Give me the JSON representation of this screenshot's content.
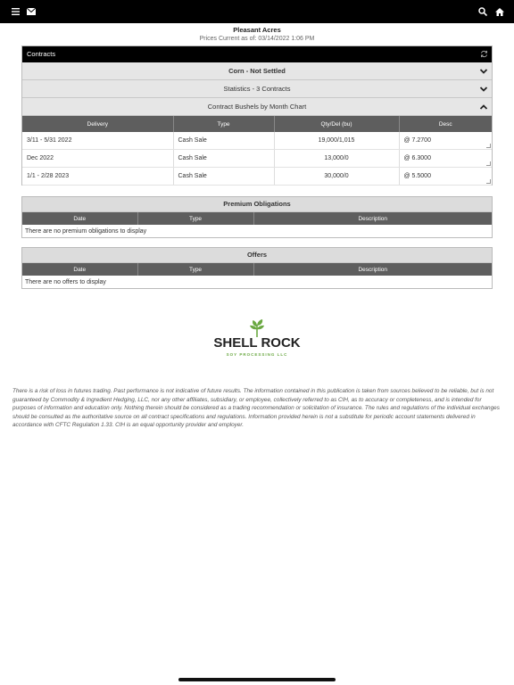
{
  "header": {
    "farm_name": "Pleasant Acres",
    "prices_current": "Prices Current as of: 03/14/2022 1:06 PM"
  },
  "contracts": {
    "title": "Contracts",
    "sections": [
      {
        "label": "Corn - Not Settled"
      },
      {
        "label": "Statistics - 3 Contracts"
      },
      {
        "label": "Contract Bushels by Month Chart"
      }
    ],
    "columns": [
      "Delivery",
      "Type",
      "Qty/Del (bu)",
      "Desc"
    ],
    "rows": [
      {
        "delivery": "3/11 - 5/31 2022",
        "type": "Cash Sale",
        "qty": "19,000/1,015",
        "desc": "@ 7.2700"
      },
      {
        "delivery": "Dec 2022",
        "type": "Cash Sale",
        "qty": "13,000/0",
        "desc": "@ 6.3000"
      },
      {
        "delivery": "1/1 - 2/28 2023",
        "type": "Cash Sale",
        "qty": "30,000/0",
        "desc": "@ 5.5000"
      }
    ]
  },
  "premium": {
    "title": "Premium Obligations",
    "columns": [
      "Date",
      "Type",
      "Description"
    ],
    "empty_text": "There are no premium obligations to display"
  },
  "offers": {
    "title": "Offers",
    "columns": [
      "Date",
      "Type",
      "Description"
    ],
    "empty_text": "There are no offers to display"
  },
  "logo": {
    "name": "SHELL ROCK",
    "sub": "SOY PROCESSING LLC"
  },
  "disclaimer": "There is a risk of loss in futures trading. Past performance is not indicative of future results. The information contained in this publication is taken from sources believed to be reliable, but is not guaranteed by Commodity & Ingredient Hedging, LLC, nor any other affiliates, subsidiary, or employee, collectively referred to as CIH, as to accuracy or completeness, and is intended for purposes of information and education only. Nothing therein should be considered as a trading recommendation or solicitation of insurance. The rules and regulations of the individual exchanges should be consulted as the authoritative source on all contract specifications and regulations. Information provided herein is not a substitute for periodic account statements delivered in accordance with CFTC Regulation 1.33. CIH is an equal opportunity provider and employer.",
  "icons": {
    "menu": "menu-icon",
    "mail": "mail-icon",
    "search": "search-icon",
    "home": "home-icon",
    "refresh": "refresh-icon",
    "chevron_down": "chevron-down-icon",
    "chevron_up": "chevron-up-icon"
  },
  "colors": {
    "topbar": "#000000",
    "table_header": "#5e5e5e",
    "accordion": "#e6e6e6",
    "logo_green": "#6aa842"
  }
}
